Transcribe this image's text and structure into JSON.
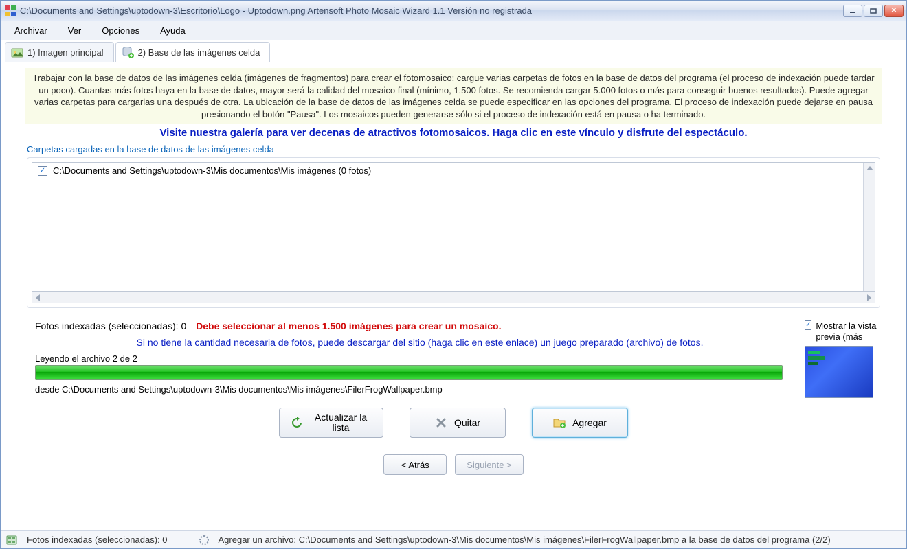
{
  "titlebar": {
    "text": "C:\\Documents and Settings\\uptodown-3\\Escritorio\\Logo - Uptodown.png Artensoft Photo Mosaic Wizard 1.1  Versión no registrada"
  },
  "menu": {
    "items": [
      "Archivar",
      "Ver",
      "Opciones",
      "Ayuda"
    ]
  },
  "tabs": {
    "items": [
      {
        "label": "1) Imagen principal",
        "active": false
      },
      {
        "label": "2) Base de las imágenes celda",
        "active": true
      }
    ]
  },
  "info": {
    "text": "Trabajar con la base de datos de las imágenes celda (imágenes de fragmentos) para crear el fotomosaico: cargue varias carpetas de fotos en la base de datos del programa (el proceso de indexación puede tardar un poco). Cuantas más fotos haya en la base de datos, mayor será la calidad del mosaico final (mínimo, 1.500 fotos. Se recomienda cargar 5.000 fotos o más para conseguir buenos resultados). Puede agregar varias carpetas para cargarlas una después de otra. La ubicación de la base de datos de las imágenes celda se puede especificar en las opciones del programa. El proceso de indexación puede dejarse en pausa presionando el botón \"Pausa\". Los mosaicos pueden generarse sólo si el proceso de indexación está en pausa o ha terminado."
  },
  "gallery_link": "Visite nuestra galería para ver decenas de atractivos fotomosaicos. Haga clic en este vínculo y disfrute del espectáculo.",
  "folders": {
    "label": "Carpetas cargadas en la base de datos de las imágenes celda",
    "items": [
      {
        "checked": true,
        "path": "C:\\Documents and Settings\\uptodown-3\\Mis documentos\\Mis imágenes (0 fotos)"
      }
    ]
  },
  "stats": {
    "indexed_label": "Fotos indexadas (seleccionadas): 0",
    "warning": "Debe seleccionar al menos 1.500 imágenes para crear un mosaico.",
    "download_link": "Si no tiene la cantidad necesaria de fotos, puede descargar del sitio (haga clic en este enlace) un juego preparado (archivo) de fotos."
  },
  "preview": {
    "checkbox_label": "Mostrar la vista previa (más"
  },
  "progress": {
    "reading": "Leyendo el archivo 2  de  2",
    "from": "desde  C:\\Documents and Settings\\uptodown-3\\Mis documentos\\Mis imágenes\\FilerFrogWallpaper.bmp",
    "percent": 100
  },
  "buttons": {
    "refresh": "Actualizar la lista",
    "remove": "Quitar",
    "add": "Agregar",
    "back": "< Atrás",
    "next": "Siguiente >"
  },
  "statusbar": {
    "indexed": "Fotos indexadas (seleccionadas): 0",
    "adding": "Agregar un archivo:  C:\\Documents and Settings\\uptodown-3\\Mis documentos\\Mis imágenes\\FilerFrogWallpaper.bmp a la base de datos del programa (2/2)"
  }
}
